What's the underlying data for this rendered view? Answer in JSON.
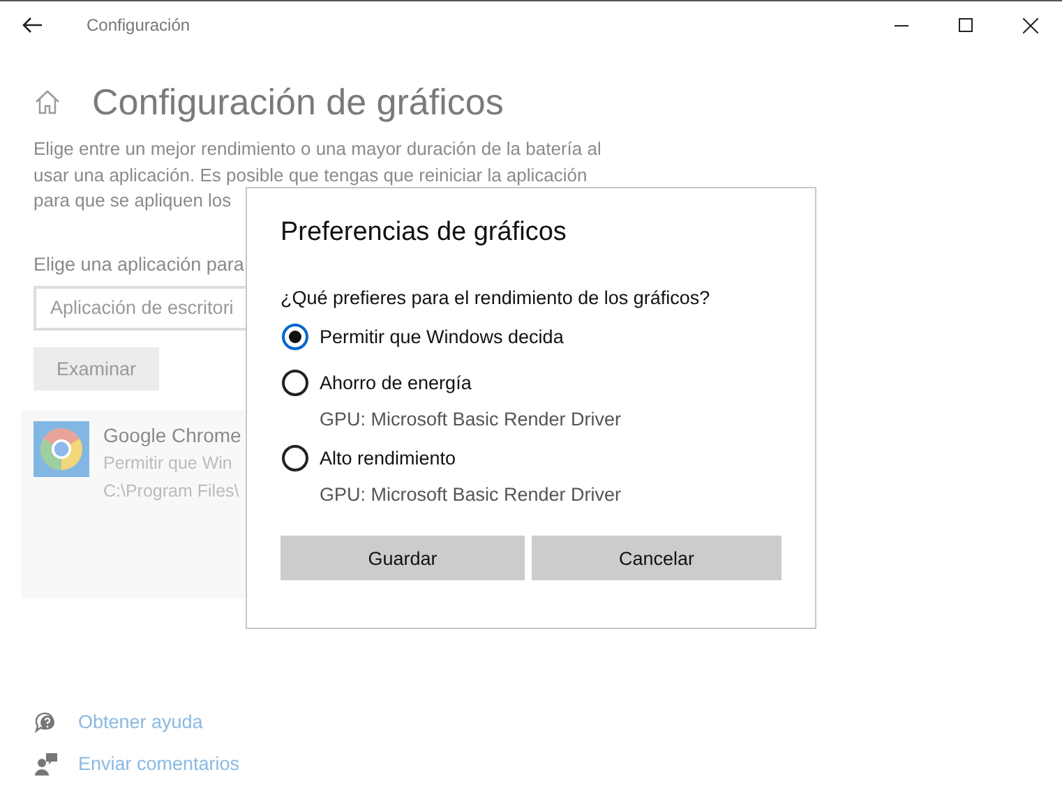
{
  "window": {
    "title": "Configuración"
  },
  "page": {
    "title": "Configuración de gráficos",
    "description": "Elige entre un mejor rendimiento o una mayor duración de la batería al\nusar una aplicación. Es posible que tengas que reiniciar la aplicación\npara que se apliquen los",
    "chooser_label": "Elige una aplicación para",
    "app_type_field": {
      "placeholder": "Aplicación de escritori"
    },
    "browse_button": "Examinar"
  },
  "apps": [
    {
      "name": "Google Chrome",
      "preference": "Permitir que Win",
      "path": "C:\\Program Files\\"
    }
  ],
  "dialog": {
    "title": "Preferencias de gráficos",
    "question": "¿Qué prefieres para el rendimiento de los gráficos?",
    "options": [
      {
        "label": "Permitir que Windows decida",
        "selected": true
      },
      {
        "label": "Ahorro de energía",
        "detail": "GPU: Microsoft Basic Render Driver",
        "selected": false
      },
      {
        "label": "Alto rendimiento",
        "detail": "GPU: Microsoft Basic Render Driver",
        "selected": false
      }
    ],
    "buttons": [
      "Guardar",
      "Cancelar"
    ]
  },
  "links": [
    {
      "kind": "help",
      "label": "Obtener ayuda"
    },
    {
      "kind": "feedback",
      "label": "Enviar comentarios"
    }
  ]
}
